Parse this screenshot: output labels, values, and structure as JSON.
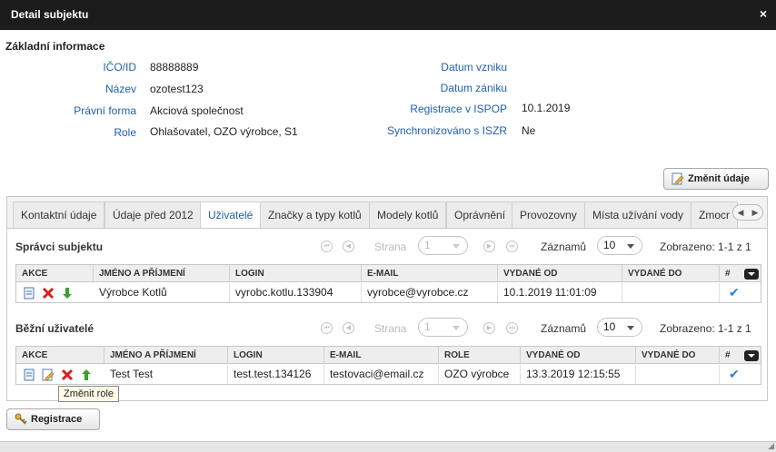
{
  "dialog": {
    "title": "Detail subjektu",
    "close_symbol": "×"
  },
  "basic": {
    "title": "Základní informace",
    "left": [
      {
        "label": "IČO/ID",
        "value": "88888889"
      },
      {
        "label": "Název",
        "value": "ozotest123"
      },
      {
        "label": "Právní forma",
        "value": "Akciová společnost"
      },
      {
        "label": "Role",
        "value": "Ohlašovatel, OZO výrobce, S1"
      }
    ],
    "right": [
      {
        "label": "Datum vzniku",
        "value": ""
      },
      {
        "label": "Datum zániku",
        "value": ""
      },
      {
        "label": "Registrace v ISPOP",
        "value": "10.1.2019"
      },
      {
        "label": "Synchronizováno s ISZR",
        "value": "Ne"
      }
    ]
  },
  "buttons": {
    "change_data": "Změnit údaje",
    "registration": "Registrace"
  },
  "tabs": [
    {
      "label": "Kontaktní údaje"
    },
    {
      "label": "Údaje před 2012"
    },
    {
      "label": "Uživatelé",
      "active": true
    },
    {
      "label": "Značky a typy kotlů"
    },
    {
      "label": "Modely kotlů"
    },
    {
      "label": "Oprávnění"
    },
    {
      "label": "Provozovny"
    },
    {
      "label": "Místa užívání vody"
    },
    {
      "label": "Zmocr"
    }
  ],
  "tabnav": {
    "prev": "◀",
    "next": "▶"
  },
  "pager": {
    "page_label": "Strana",
    "page_value": "1",
    "records_label": "Záznamů",
    "records_value": "10",
    "shown": "Zobrazeno: 1-1 z 1",
    "first": "⏮",
    "prev": "◀",
    "next": "▶",
    "last": "⏭"
  },
  "admins": {
    "title": "Správci subjektu",
    "columns": [
      "AKCE",
      "JMÉNO A PŘÍJMENÍ",
      "LOGIN",
      "E-MAIL",
      "VYDANÉ OD",
      "VYDANÉ DO",
      "#"
    ],
    "rows": [
      {
        "name": "Výrobce Kotlů",
        "login": "vyrobc.kotlu.133904",
        "email": "vyrobce@vyrobce.cz",
        "from": "10.1.2019 11:01:09",
        "to": "",
        "check": "✔"
      }
    ]
  },
  "users": {
    "title": "Běžní uživatelé",
    "columns": [
      "AKCE",
      "JMÉNO A PŘÍJMENÍ",
      "LOGIN",
      "E-MAIL",
      "ROLE",
      "VYDANÉ OD",
      "VYDANÉ DO",
      "#"
    ],
    "rows": [
      {
        "name": "Test Test",
        "login": "test.test.134126",
        "email": "testovaci@email.cz",
        "role": "OZO výrobce",
        "from": "13.3.2019 12:15:55",
        "to": "",
        "check": "✔"
      }
    ]
  },
  "tooltip": "Změnit role",
  "colors": {
    "accent": "#2060b0",
    "titlebar": "#1c1c1c"
  }
}
